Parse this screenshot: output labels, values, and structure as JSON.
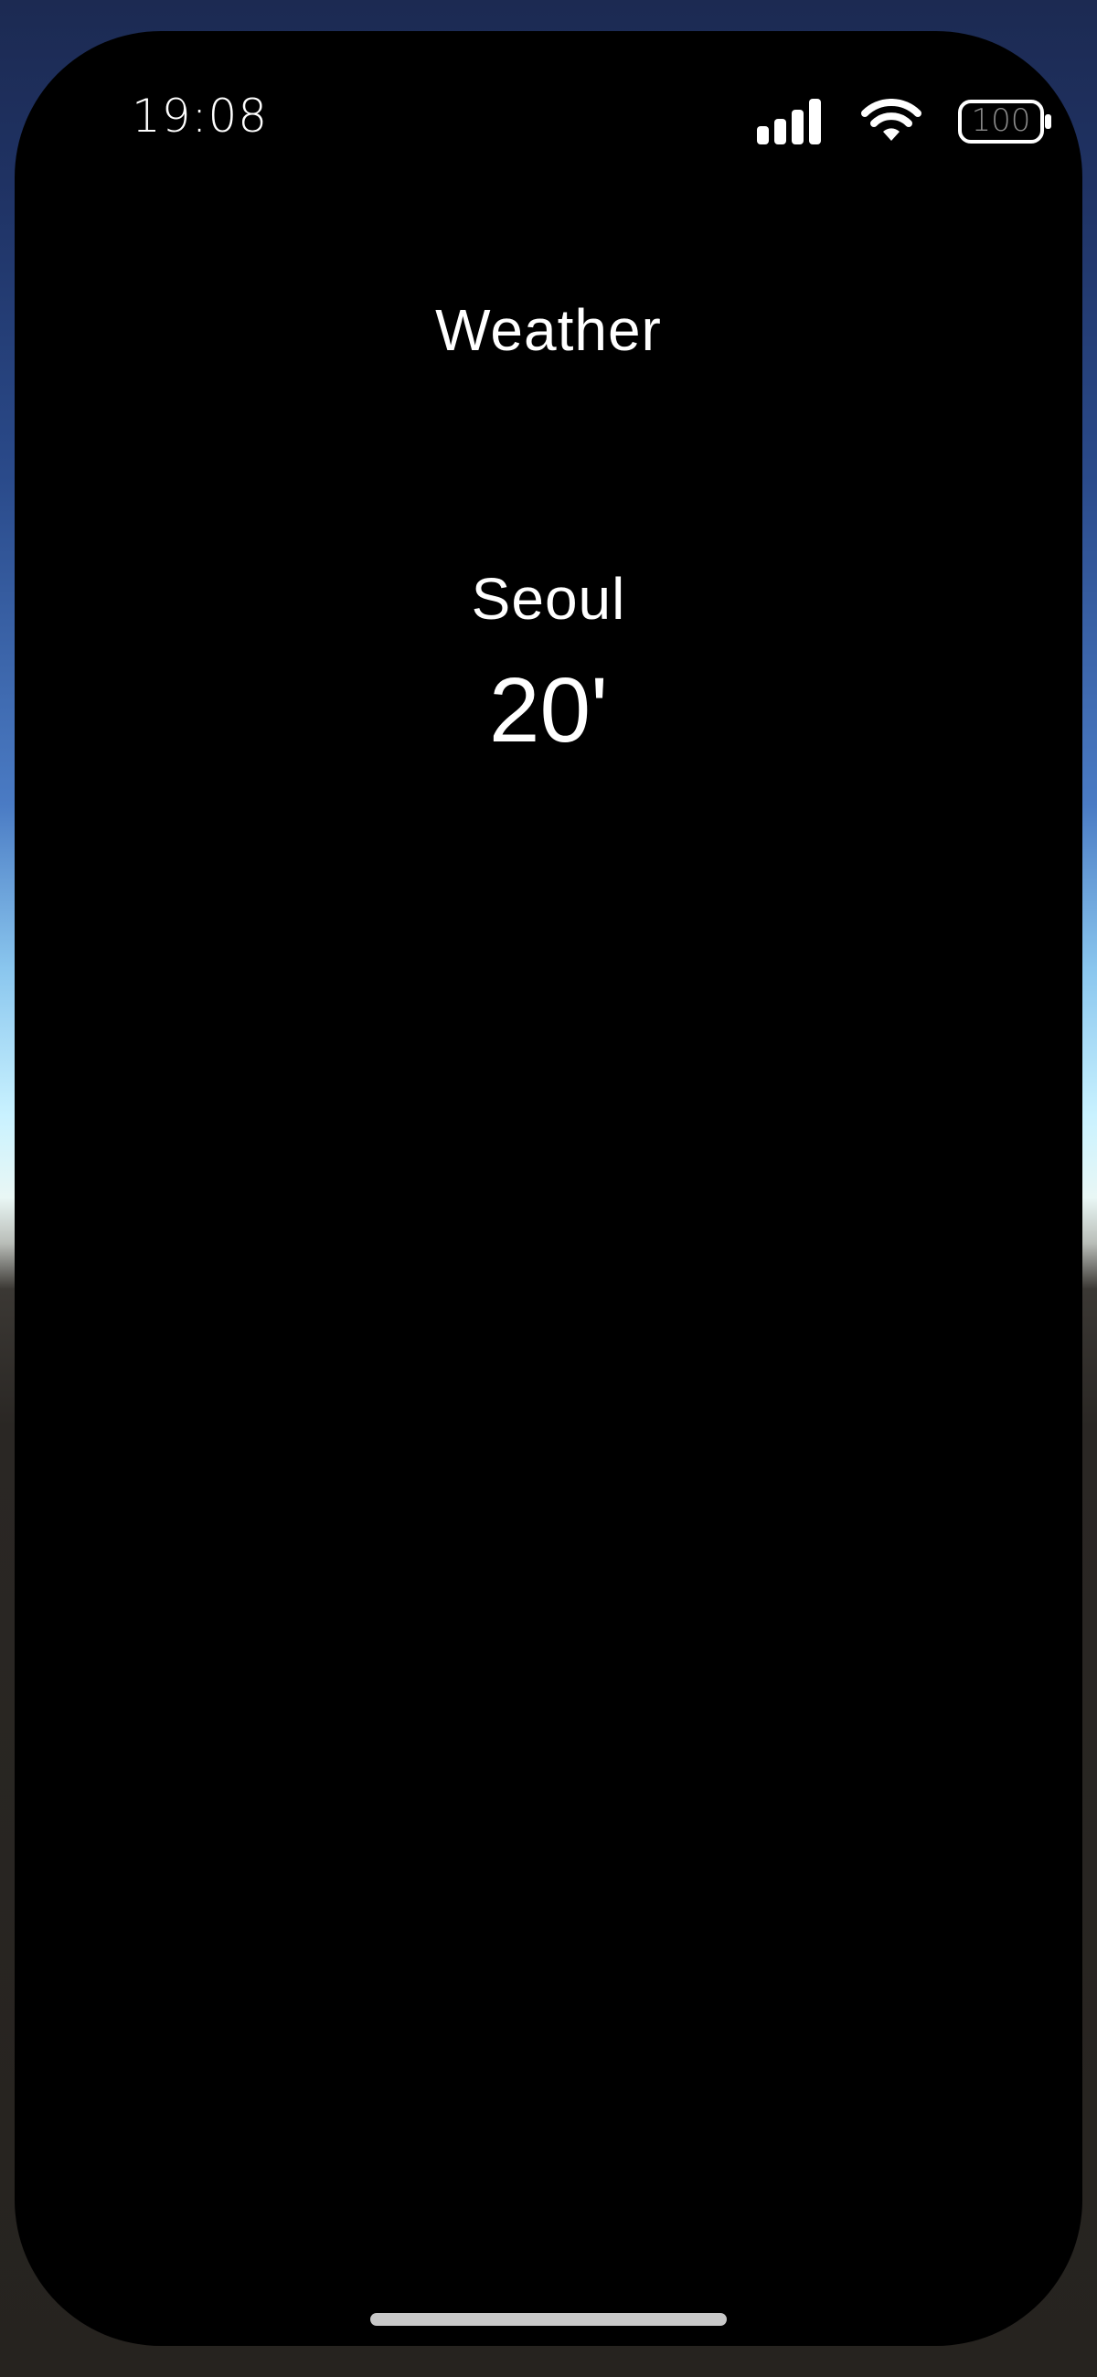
{
  "status_bar": {
    "time": "19:08",
    "battery_level": "100",
    "icons": [
      "cellular-signal-icon",
      "wifi-icon",
      "battery-icon"
    ]
  },
  "app": {
    "title": "Weather"
  },
  "weather": {
    "city": "Seoul",
    "temperature": "20'"
  },
  "colors": {
    "screen_background": "#000000",
    "text": "#ffffff",
    "home_indicator": "#c8c8c8"
  }
}
